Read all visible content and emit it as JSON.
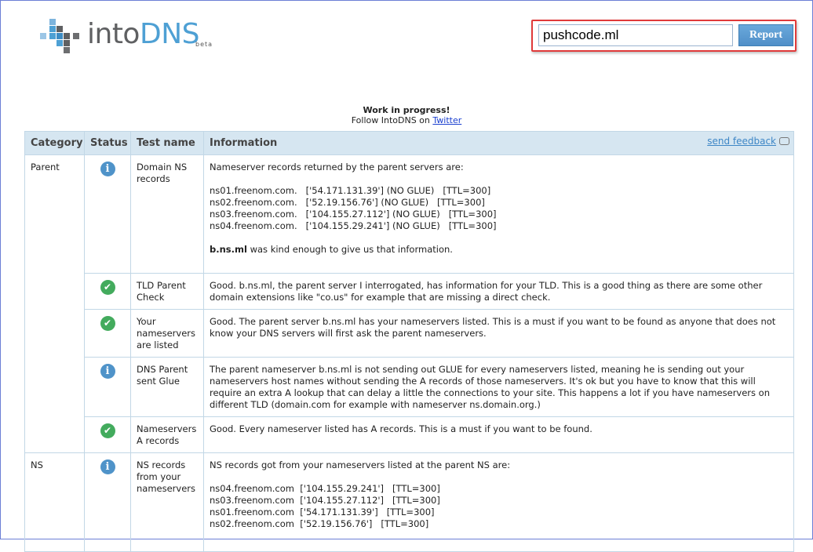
{
  "logo": {
    "into": "intoDNS",
    "into_part": "into",
    "dns_part": "DNS",
    "beta": "beta"
  },
  "search": {
    "value": "pushcode.ml",
    "button_label": "Report"
  },
  "notice": {
    "title": "Work in progress!",
    "follow_text": "Follow IntoDNS on ",
    "twitter_link": "Twitter"
  },
  "table": {
    "headers": {
      "category": "Category",
      "status": "Status",
      "test": "Test name",
      "info": "Information"
    },
    "feedback_label": "send feedback",
    "rows": [
      {
        "category": "Parent",
        "status": "info",
        "test": "Domain NS records",
        "intro": "Nameserver records returned by the parent servers are:",
        "lines": [
          "ns01.freenom.com.   ['54.171.131.39'] (NO GLUE)   [TTL=300]",
          "ns02.freenom.com.   ['52.19.156.76'] (NO GLUE)   [TTL=300]",
          "ns03.freenom.com.   ['104.155.27.112'] (NO GLUE)   [TTL=300]",
          "ns04.freenom.com.   ['104.155.29.241'] (NO GLUE)   [TTL=300]"
        ],
        "footer_bold": "b.ns.ml",
        "footer_rest": " was kind enough to give us that information."
      },
      {
        "category": "",
        "status": "ok",
        "test": "TLD Parent Check",
        "text": "Good. b.ns.ml, the parent server I interrogated, has information for your TLD. This is a good thing as there are some other domain extensions like \"co.us\" for example that are missing a direct check."
      },
      {
        "category": "",
        "status": "ok",
        "test": "Your nameservers are listed",
        "text": "Good. The parent server b.ns.ml has your nameservers listed. This is a must if you want to be found as anyone that does not know your DNS servers will first ask the parent nameservers."
      },
      {
        "category": "",
        "status": "info",
        "test": "DNS Parent sent Glue",
        "text": "The parent nameserver b.ns.ml is not sending out GLUE for every nameservers listed, meaning he is sending out your nameservers host names without sending the A records of those nameservers. It's ok but you have to know that this will require an extra A lookup that can delay a little the connections to your site. This happens a lot if you have nameservers on different TLD (domain.com for example with nameserver ns.domain.org.)"
      },
      {
        "category": "",
        "status": "ok",
        "test": "Nameservers A records",
        "text": "Good. Every nameserver listed has A records. This is a must if you want to be found."
      },
      {
        "category": "NS",
        "status": "info",
        "test": "NS records from your nameservers",
        "intro": "NS records got from your nameservers listed at the parent NS are:",
        "lines": [
          "ns04.freenom.com  ['104.155.29.241']   [TTL=300]",
          "ns03.freenom.com  ['104.155.27.112']   [TTL=300]",
          "ns01.freenom.com  ['54.171.131.39']   [TTL=300]",
          "ns02.freenom.com  ['52.19.156.76']   [TTL=300]"
        ]
      }
    ]
  },
  "colors": {
    "brand_blue": "#4ea0d4",
    "logo_gray": "#5f6062",
    "header_bg": "#d6e6f1",
    "ok_green": "#43ab5d",
    "info_blue": "#4f93c9",
    "highlight_red": "#e03a3a"
  },
  "icons": {
    "info": "info-icon",
    "ok": "check-icon",
    "feedback": "speech-bubble-icon"
  }
}
